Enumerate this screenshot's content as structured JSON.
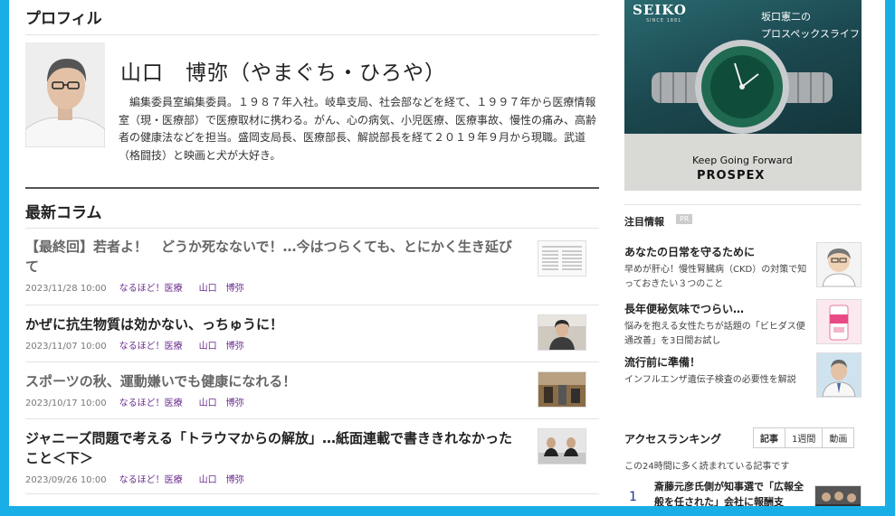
{
  "profile": {
    "section_title": "プロフィル",
    "name": "山口　博弥（やまぐち・ひろや）",
    "bio": "編集委員室編集委員。１９８７年入社。岐阜支局、社会部などを経て、１９９７年から医療情報室（現・医療部）で医療取材に携わる。がん、心の病気、小児医療、医療事故、慢性の痛み、高齢者の健康法などを担当。盛岡支局長、医療部長、解説部長を経て２０１９年９月から現職。武道（格闘技）と映画と犬が大好き。"
  },
  "columns": {
    "section_title": "最新コラム",
    "articles": [
      {
        "title": "【最終回】若者よ！　どうか死なないで！…今はつらくても、とにかく生き延びて",
        "date": "2023/11/28 10:00",
        "category": "なるほど！医療",
        "author": "山口　博弥"
      },
      {
        "title": "かぜに抗生物質は効かない、っちゅうに！",
        "date": "2023/11/07 10:00",
        "category": "なるほど！医療",
        "author": "山口　博弥"
      },
      {
        "title": "スポーツの秋、運動嫌いでも健康になれる！",
        "date": "2023/10/17 10:00",
        "category": "なるほど！医療",
        "author": "山口　博弥"
      },
      {
        "title": "ジャニーズ問題で考える「トラウマからの解放」…紙面連載で書ききれなかったこと＜下＞",
        "date": "2023/09/26 10:00",
        "category": "なるほど！医療",
        "author": "山口　博弥"
      }
    ]
  },
  "ad": {
    "brand": "SEIKO",
    "since": "SINCE 1881",
    "headline_1": "坂口憲二の",
    "headline_2": "プロスペックスライフ",
    "tagline": "Keep Going Forward",
    "product": "PROSPEX",
    "accent_color": "#1c4850"
  },
  "notices": {
    "title": "注目情報",
    "badge": "PR",
    "items": [
      {
        "head": "あなたの日常を守るために",
        "body": "早めが肝心！慢性腎臓病（CKD）の対策で知っておきたい３つのこと"
      },
      {
        "head": "長年便秘気味でつらい…",
        "body": "悩みを抱える女性たちが話題の「ビヒダス便通改善」を3日間お試し"
      },
      {
        "head": "流行前に準備！",
        "body": "インフルエンザ遺伝子検査の必要性を解説"
      }
    ]
  },
  "ranking": {
    "title": "アクセスランキング",
    "tabs": [
      "記事",
      "1週間",
      "動画"
    ],
    "description": "この24時間に多く読まれている記事です",
    "items": [
      {
        "rank": "1",
        "title": "斎藤元彦氏側が知事選で「広報全般を任された」会社に報酬支"
      }
    ]
  },
  "colors": {
    "frame": "#19aee6",
    "category_link": "#6a2b8e",
    "rank_number": "#1b3a8a"
  }
}
